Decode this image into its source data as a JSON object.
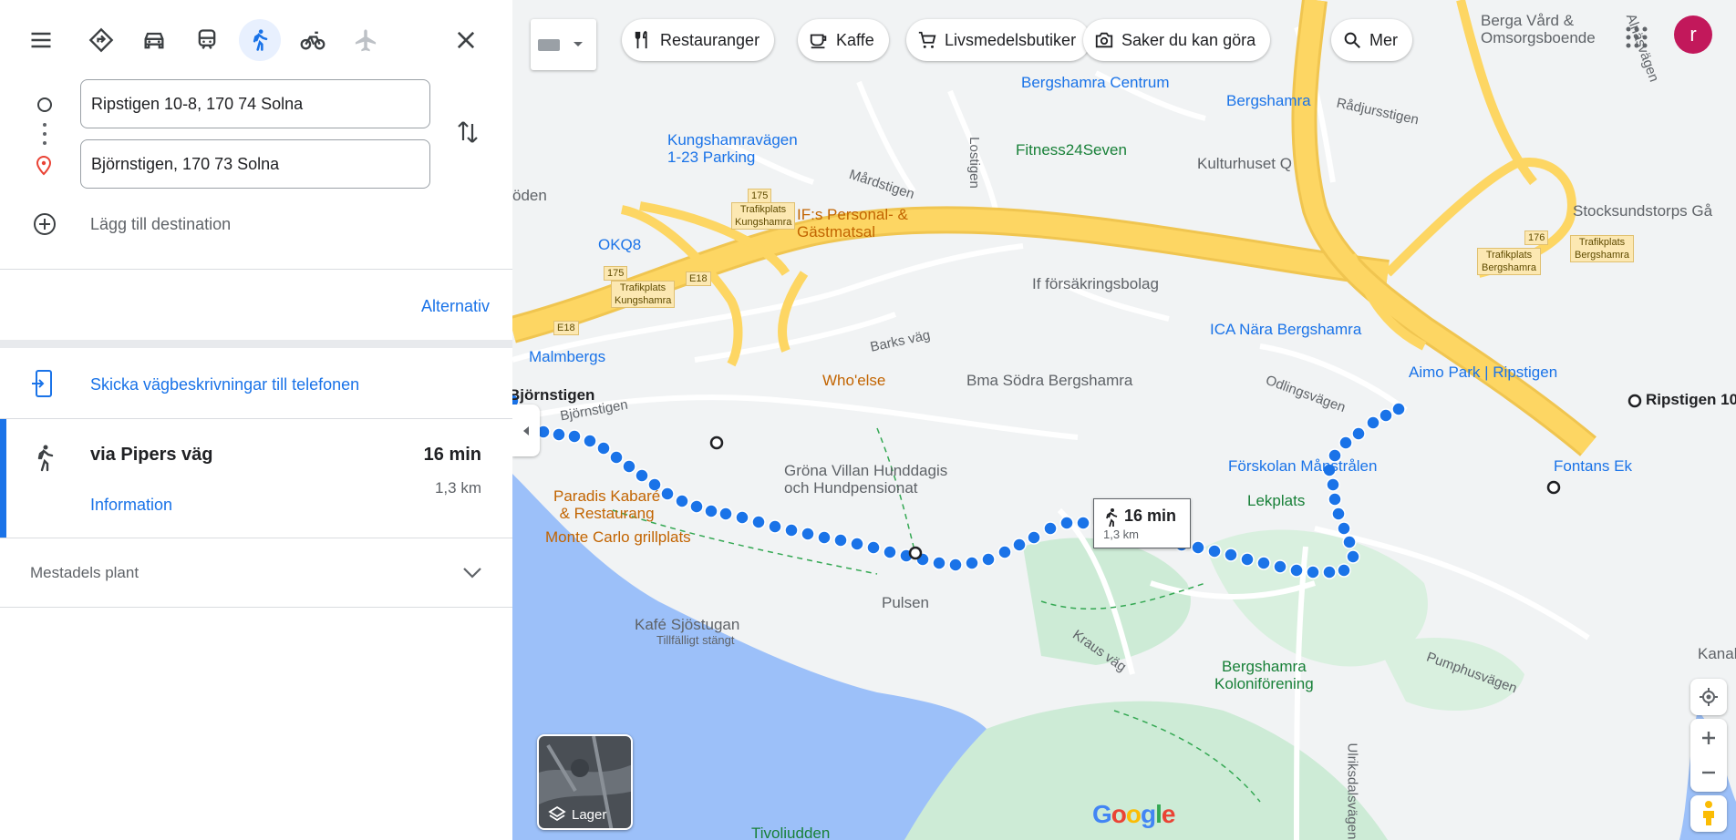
{
  "search": {
    "origin": "Ripstigen 10-8, 170 74 Solna",
    "destination": "Björnstigen, 170 73 Solna",
    "add_destination": "Lägg till destination"
  },
  "modes": [
    {
      "name": "best",
      "active": false
    },
    {
      "name": "car",
      "active": false
    },
    {
      "name": "transit",
      "active": false
    },
    {
      "name": "walk",
      "active": true
    },
    {
      "name": "bike",
      "active": false
    },
    {
      "name": "flight",
      "active": false
    }
  ],
  "options_link": "Alternativ",
  "send_to_phone": "Skicka vägbeskrivningar till telefonen",
  "route": {
    "title": "via Pipers väg",
    "time": "16 min",
    "distance": "1,3 km",
    "details_link": "Information"
  },
  "terrain_note": "Mestadels plant",
  "map": {
    "chips": [
      "Restauranger",
      "Kaffe",
      "Livsmedelsbutiker",
      "Saker du kan göra",
      "Mer"
    ],
    "callout_time": "16 min",
    "callout_distance": "1,3 km",
    "layers_label": "Lager",
    "google_logo": "Google",
    "user_initial": "r",
    "labels": {
      "berga": "Berga Vård &\nOmsorgsboende",
      "bergshamra_centrum": "Bergshamra Centrum",
      "bergshamra_station": "Bergshamra",
      "radjursstigen": "Rådjursstigen",
      "almsvagen": "Alnäsvägen",
      "kungshamra_parking": "Kungshamravägen\n1-23 Parking",
      "fitness": "Fitness24Seven",
      "kulturhuset": "Kulturhuset Q",
      "mardstigen": "Mårdstigen",
      "lostigen": "Lostigen",
      "stocksund": "Stocksundstorps Gå",
      "oden": "öden",
      "okq8": "OKQ8",
      "ifs": "IF:s Personal- &\nGästmatsal",
      "if_forsakring": "If försäkringsbolag",
      "ica": "ICA Nära Bergshamra",
      "malmbergs": "Malmbergs",
      "barks_vag": "Barks väg",
      "whoelse": "Who'else",
      "bma": "Bma Södra Bergshamra",
      "aimo": "Aimo Park | Ripstigen",
      "odlingsvagen": "Odlingsvägen",
      "ripstigen": "Ripstigen 10",
      "bjornstigen_pin": "Björnstigen",
      "bjornstigen_road": "Björnstigen",
      "grona_villan": "Gröna Villan Hunddagis\noch Hundpensionat",
      "forskolan": "Förskolan Månstrålen",
      "fontans": "Fontans Ek",
      "lekplats": "Lekplats",
      "paradis": "Paradis Kabaré\n& Restaurang",
      "monte_carlo": "Monte Carlo grillplats",
      "pulsen": "Pulsen",
      "kafe": "Kafé Sjöstugan",
      "tillfalligt": "Tillfälligt stängt",
      "kraus": "Kraus väg",
      "kolonif": "Bergshamra\nKoloniförening",
      "pumphus": "Pumphusvägen",
      "kanal": "Kanal",
      "tivoli": "Tivoliudden",
      "ulrik": "Ulriksdalsvägen",
      "tl_kungshamra": "Trafikplats\nKungshamra",
      "tl_bergshamra": "Trafikplats\nBergshamra",
      "r175": "175",
      "r176": "176",
      "e18": "E18"
    }
  },
  "colors": {
    "accent": "#1a73e8",
    "route_dot": "#1a73e8",
    "highway": "#fdd663",
    "water": "#9cc0f9",
    "park": "#cdebd6"
  }
}
